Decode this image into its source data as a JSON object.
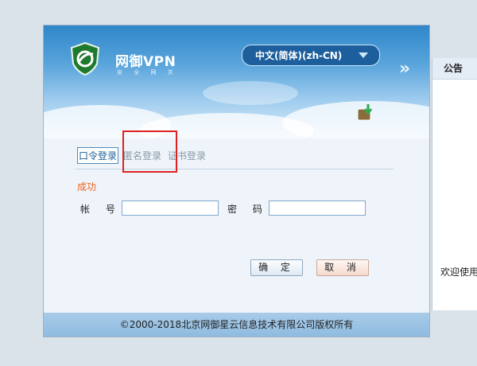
{
  "header": {
    "brand_name": "网御VPN",
    "brand_subtitle": "安 全 网 关",
    "language_selected": "中文(简体)(zh-CN)",
    "expand_arrows": "»"
  },
  "tabs": [
    {
      "label": "口令登录",
      "active": true
    },
    {
      "label": "匿名登录",
      "active": false
    },
    {
      "label": "证书登录",
      "active": false
    }
  ],
  "form": {
    "status_text": "成功",
    "account_label": "帐 号:",
    "account_value": "",
    "password_label": "密 码:",
    "password_value": ""
  },
  "buttons": {
    "ok_label": "确 定",
    "cancel_label": "取 消"
  },
  "footer": {
    "copyright": "©2000-2018北京网御星云信息技术有限公司版权所有"
  },
  "announcement": {
    "title": "公告",
    "text": "欢迎使用"
  },
  "colors": {
    "highlight_box": "#e02020",
    "status_text": "#f0641e",
    "active_tab": "#1f5f99"
  },
  "icons": [
    "shield-logo-icon",
    "dropdown-caret-icon",
    "double-chevron-right-icon",
    "download-icon"
  ]
}
